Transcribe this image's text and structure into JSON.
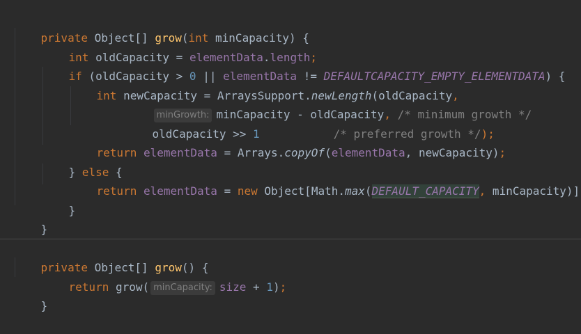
{
  "code": {
    "grow_method": {
      "sig_private": "private",
      "sig_type": "Object[]",
      "sig_name": "grow",
      "sig_paren_open": "(",
      "sig_param_type": "int",
      "sig_param_name": "minCapacity",
      "sig_end": ") {",
      "l2_type": "int",
      "l2_var": "oldCapacity = ",
      "l2_field": "elementData",
      "l2_dot": ".",
      "l2_length": "length",
      "l2_semi": ";",
      "l3_if": "if",
      "l3_a": " (oldCapacity > ",
      "l3_zero": "0",
      "l3_or": " || ",
      "l3_field": "elementData",
      "l3_ne": " != ",
      "l3_const": "DEFAULTCAPACITY_EMPTY_ELEMENTDATA",
      "l3_end": ") {",
      "l4_type": "int",
      "l4_a": " newCapacity = ArraysSupport.",
      "l4_method": "newLength",
      "l4_b": "(oldCapacity",
      "l4_comma": ",",
      "l5_hint": "minGrowth:",
      "l5_a": "minCapacity - oldCapacity",
      "l5_comma": ",",
      "l5_comment": " /* minimum growth */",
      "l6_a": "oldCapacity >> ",
      "l6_num": "1",
      "l6_comment": "           /* preferred growth */",
      "l6_end": ");",
      "l7_return": "return",
      "l7_field": "elementData",
      "l7_a": " = Arrays.",
      "l7_method": "copyOf",
      "l7_b": "(",
      "l7_field2": "elementData",
      "l7_c": ", newCapacity)",
      "l7_semi": ";",
      "l8_a": "} ",
      "l8_else": "else",
      "l8_b": " {",
      "l9_return": "return",
      "l9_field": "elementData",
      "l9_a": " = ",
      "l9_new": "new",
      "l9_b": " Object[Math.",
      "l9_method": "max",
      "l9_c": "(",
      "l9_const": "DEFAULT_CAPACITY",
      "l9_comma": ",",
      "l9_d": " minCapacity)]",
      "l9_semi": ";",
      "l10": "}",
      "l11": "}"
    },
    "grow_overload": {
      "sig_private": "private",
      "sig_type": "Object[]",
      "sig_name": "grow",
      "sig_end": "() {",
      "l2_return": "return",
      "l2_call": " grow(",
      "l2_hint": "minCapacity:",
      "l2_field": "size",
      "l2_a": " + ",
      "l2_num": "1",
      "l2_b": ")",
      "l2_semi": ";",
      "l3": "}"
    }
  }
}
